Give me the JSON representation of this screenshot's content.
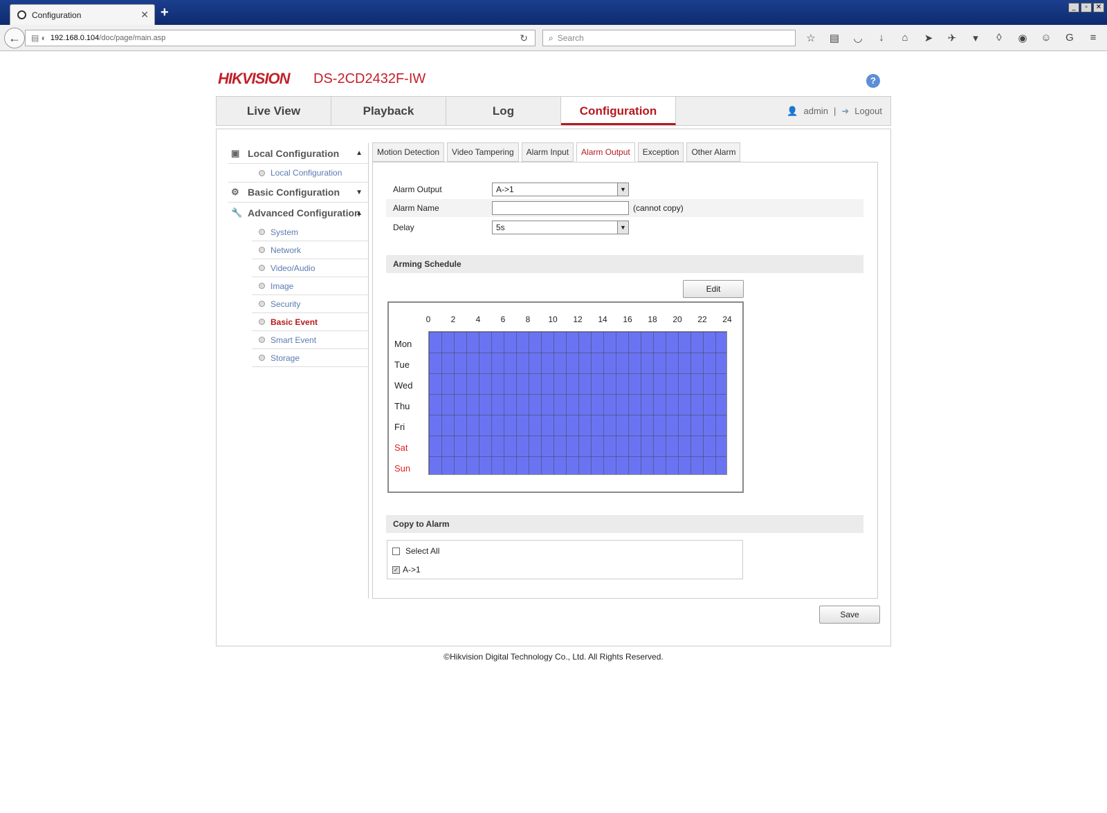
{
  "browser": {
    "tab_title": "Configuration",
    "new_tab": "+",
    "window_buttons": [
      "_",
      "▫",
      "✕"
    ],
    "url_host": "192.168.0.104",
    "url_path": "/doc/page/main.asp",
    "search_placeholder": "Search",
    "toolbar_icons": [
      "star-icon",
      "reading-list-icon",
      "pocket-icon",
      "download-icon",
      "home-icon",
      "send-icon",
      "bird-icon",
      "dropdown-icon",
      "drop-icon",
      "circle-arrow-icon",
      "chat-icon",
      "g-icon",
      "menu-icon"
    ]
  },
  "header": {
    "logo": "HIKVISION",
    "model": "DS-2CD2432F-IW",
    "help": "?"
  },
  "topnav": {
    "tabs": [
      "Live View",
      "Playback",
      "Log",
      "Configuration"
    ],
    "active": "Configuration",
    "user": "admin",
    "separator": "|",
    "logout": "Logout"
  },
  "sidebar": {
    "local": {
      "label": "Local Configuration",
      "items": [
        "Local Configuration"
      ]
    },
    "basic": {
      "label": "Basic Configuration"
    },
    "advanced": {
      "label": "Advanced Configuration",
      "items": [
        "System",
        "Network",
        "Video/Audio",
        "Image",
        "Security",
        "Basic Event",
        "Smart Event",
        "Storage"
      ]
    },
    "active_item": "Basic Event"
  },
  "content_tabs": {
    "tabs": [
      "Motion Detection",
      "Video Tampering",
      "Alarm Input",
      "Alarm Output",
      "Exception",
      "Other Alarm"
    ],
    "active": "Alarm Output"
  },
  "form": {
    "alarm_output_label": "Alarm Output",
    "alarm_output_value": "A->1",
    "alarm_name_label": "Alarm Name",
    "alarm_name_value": "",
    "alarm_name_note": "(cannot copy)",
    "delay_label": "Delay",
    "delay_value": "5s"
  },
  "schedule": {
    "title": "Arming Schedule",
    "edit_label": "Edit",
    "hours": [
      "0",
      "2",
      "4",
      "6",
      "8",
      "10",
      "12",
      "14",
      "16",
      "18",
      "20",
      "22",
      "24"
    ],
    "days": [
      "Mon",
      "Tue",
      "Wed",
      "Thu",
      "Fri",
      "Sat",
      "Sun"
    ],
    "weekend_color": "#e02020",
    "armed_color": "#6a74f2",
    "coverage": "all days, 0–24 armed"
  },
  "copy": {
    "title": "Copy to Alarm",
    "select_all": "Select All",
    "select_all_checked": false,
    "item": "A->1",
    "item_checked": true
  },
  "save_label": "Save",
  "copyright": "©Hikvision Digital Technology Co., Ltd. All Rights Reserved.",
  "colors": {
    "brand": "#c2212b",
    "active": "#b6181f",
    "link": "#5b7bb2"
  }
}
